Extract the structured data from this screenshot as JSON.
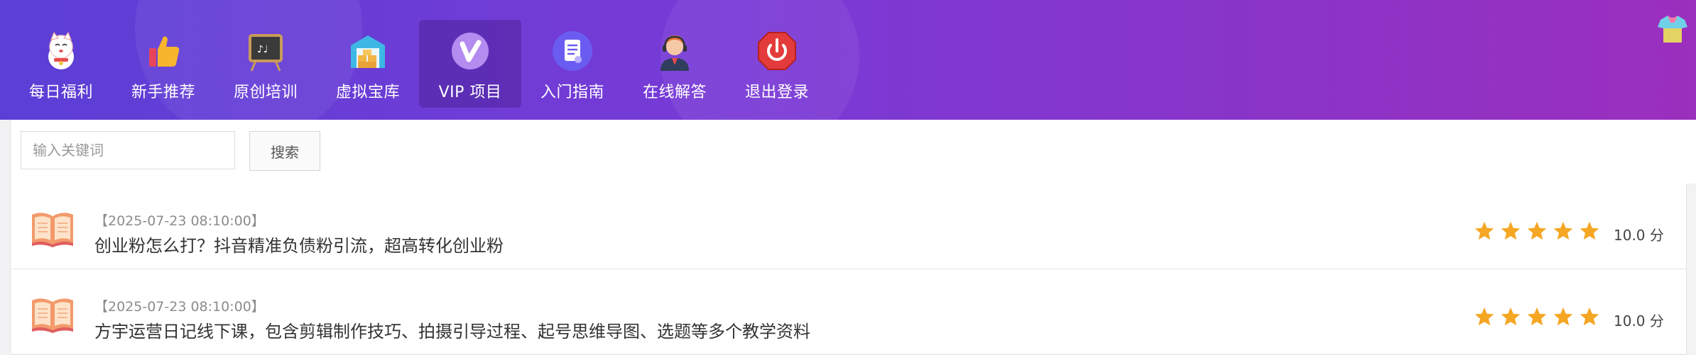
{
  "nav": {
    "items": [
      {
        "label": "每日福利",
        "icon": "lucky-cat-icon"
      },
      {
        "label": "新手推荐",
        "icon": "thumbs-up-icon"
      },
      {
        "label": "原创培训",
        "icon": "chalkboard-icon"
      },
      {
        "label": "虚拟宝库",
        "icon": "warehouse-icon"
      },
      {
        "label": "VIP 项目",
        "icon": "vip-icon",
        "active": true
      },
      {
        "label": "入门指南",
        "icon": "document-icon"
      },
      {
        "label": "在线解答",
        "icon": "support-agent-icon"
      },
      {
        "label": "退出登录",
        "icon": "power-icon"
      }
    ]
  },
  "search": {
    "placeholder": "输入关键词",
    "value": "",
    "button_label": "搜索"
  },
  "articles": [
    {
      "date": "【2025-07-23 08:10:00】",
      "title": "创业粉怎么打？抖音精准负债粉引流，超高转化创业粉",
      "stars": 5,
      "score": "10.0 分"
    },
    {
      "date": "【2025-07-23 08:10:00】",
      "title": "方宇运营日记线下课，包含剪辑制作技巧、拍摄引导过程、起号思维导图、选题等多个教学资料",
      "stars": 5,
      "score": "10.0 分"
    }
  ],
  "colors": {
    "header_start": "#5b3fd6",
    "header_end": "#9b2fbe",
    "star": "#f5a623",
    "book": "#f08a5d"
  }
}
